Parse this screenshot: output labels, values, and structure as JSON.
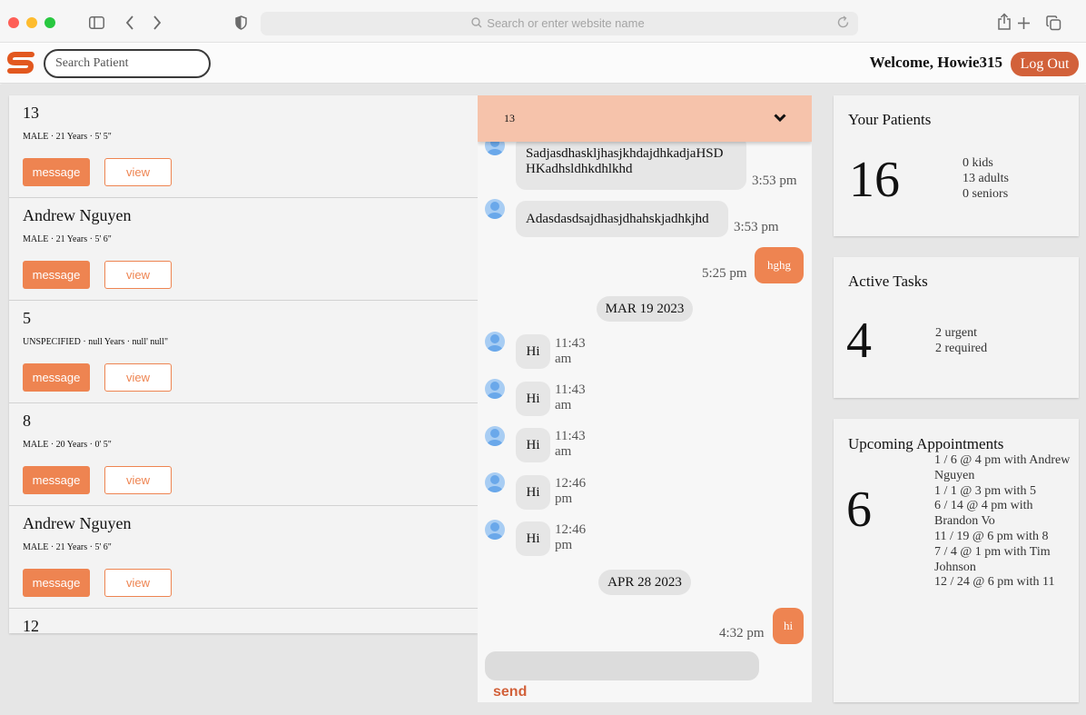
{
  "browser": {
    "url_placeholder": "Search or enter website name"
  },
  "header": {
    "search_placeholder": "Search Patient",
    "welcome": "Welcome, Howie315",
    "logout_label": "Log Out"
  },
  "patients": [
    {
      "name": "13",
      "meta": "MALE  ·  21 Years  ·  5' 5\"",
      "message_label": "message",
      "view_label": "view"
    },
    {
      "name": "Andrew Nguyen",
      "meta": "MALE  ·  21 Years  ·  5' 6\"",
      "message_label": "message",
      "view_label": "view"
    },
    {
      "name": "5",
      "meta": "UNSPECIFIED  ·  null Years  ·  null' null\"",
      "message_label": "message",
      "view_label": "view"
    },
    {
      "name": "8",
      "meta": "MALE  ·  20 Years  ·  0' 5\"",
      "message_label": "message",
      "view_label": "view"
    },
    {
      "name": "Andrew Nguyen",
      "meta": "MALE  ·  21 Years  ·  5' 6\"",
      "message_label": "message",
      "view_label": "view"
    },
    {
      "name": "12",
      "meta": "",
      "message_label": "",
      "view_label": ""
    }
  ],
  "chat": {
    "recipient": "13",
    "messages": [
      {
        "direction": "in",
        "text_line1": "SadjasdhaskljhasjkhdajdhkadjaHSD",
        "text_line2": "HKadhsldhkdhlkhd",
        "time": "3:53 pm"
      },
      {
        "direction": "in",
        "text": "Adasdasdsajdhasjdhahskjadhkjhd",
        "time": "3:53 pm"
      },
      {
        "direction": "out",
        "text": "hghg",
        "time": "5:25 pm"
      },
      {
        "date": "MAR 19 2023"
      },
      {
        "direction": "in",
        "text": "Hi",
        "time_line1": "11:43",
        "time_line2": "am"
      },
      {
        "direction": "in",
        "text": "Hi",
        "time_line1": "11:43",
        "time_line2": "am"
      },
      {
        "direction": "in",
        "text": "Hi",
        "time_line1": "11:43",
        "time_line2": "am"
      },
      {
        "direction": "in",
        "text": "Hi",
        "time_line1": "12:46",
        "time_line2": "pm"
      },
      {
        "direction": "in",
        "text": "Hi",
        "time_line1": "12:46",
        "time_line2": "pm"
      },
      {
        "date": "APR 28 2023"
      },
      {
        "direction": "out",
        "text": "hi",
        "time": "4:32 pm"
      }
    ],
    "send_label": "send"
  },
  "stats": {
    "patients": {
      "title": "Your Patients",
      "count": "16",
      "lines": [
        "0 kids",
        "13 adults",
        "0 seniors"
      ]
    },
    "tasks": {
      "title": "Active Tasks",
      "count": "4",
      "lines": [
        "2 urgent",
        "2 required"
      ]
    },
    "appointments": {
      "title": "Upcoming Appointments",
      "count": "6",
      "lines": [
        "1 / 6 @ 4 pm with Andrew Nguyen",
        "1 / 1 @ 3 pm with 5",
        "6 / 14 @ 4 pm with Brandon Vo",
        "11 / 19 @ 6 pm with 8",
        "7 / 4 @ 1 pm with Tim Johnson",
        "12 / 24 @ 6 pm with 11"
      ]
    }
  },
  "colors": {
    "accent": "#ee8451",
    "logout": "#d2613a",
    "chat_header": "#f6c3ab"
  }
}
